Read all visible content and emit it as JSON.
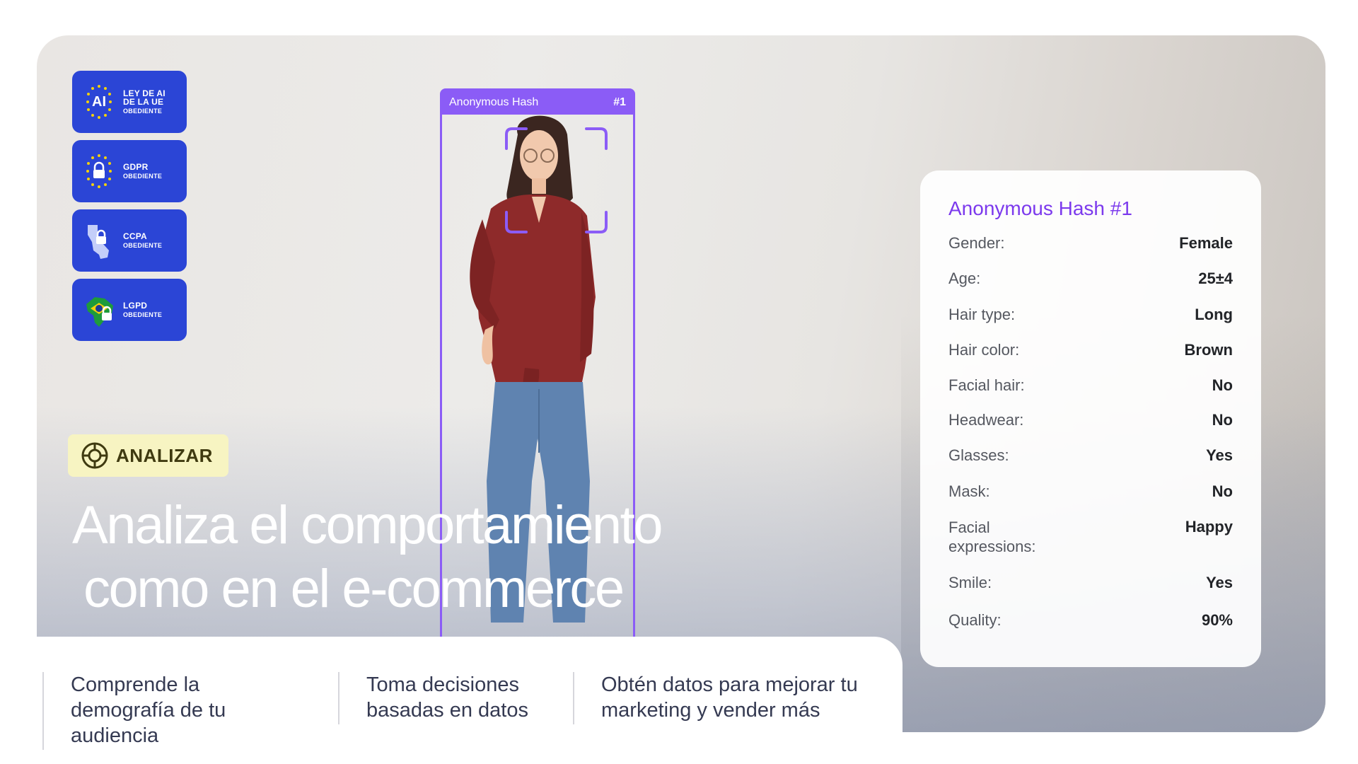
{
  "badges": [
    {
      "icon": "eu-ai-act-icon",
      "title_lines": [
        "LEY DE AI",
        "DE LA UE"
      ],
      "sub": "OBEDIENTE",
      "icon_text": "AI"
    },
    {
      "icon": "gdpr-lock-icon",
      "title_lines": [
        "GDPR"
      ],
      "sub": "OBEDIENTE"
    },
    {
      "icon": "ccpa-california-icon",
      "title_lines": [
        "CCPA"
      ],
      "sub": "OBEDIENTE"
    },
    {
      "icon": "lgpd-brazil-icon",
      "title_lines": [
        "LGPD"
      ],
      "sub": "OBEDIENTE"
    }
  ],
  "bbox": {
    "label": "Anonymous Hash",
    "id": "#1"
  },
  "tag": {
    "label": "ANALIZAR",
    "icon": "analyze-target-icon",
    "color": "#f7f4c2"
  },
  "headline": {
    "line1": "Analiza el comportamiento",
    "line2": "como en el e-commerce"
  },
  "card": {
    "title": "Anonymous Hash #1",
    "rows": [
      {
        "k": "Gender:",
        "v": "Female"
      },
      {
        "k": "Age:",
        "v": "25±4"
      },
      {
        "k": "Hair type:",
        "v": "Long"
      },
      {
        "k": "Hair color:",
        "v": "Brown"
      },
      {
        "k": "Facial hair:",
        "v": "No"
      },
      {
        "k": "Headwear:",
        "v": "No"
      },
      {
        "k": "Glasses:",
        "v": "Yes"
      },
      {
        "k": "Mask:",
        "v": "No"
      },
      {
        "k": "Facial expressions:",
        "v": "Happy"
      },
      {
        "k": "Smile:",
        "v": "Yes"
      },
      {
        "k": "Quality:",
        "v": "90%"
      }
    ]
  },
  "features": [
    "Comprende la demografía de tu audiencia",
    "Toma decisiones basadas en datos",
    "Obtén datos para mejorar tu marketing y vender más"
  ],
  "colors": {
    "badge": "#2b45d6",
    "accent": "#8b5cf6",
    "card_title": "#7c3aed"
  }
}
